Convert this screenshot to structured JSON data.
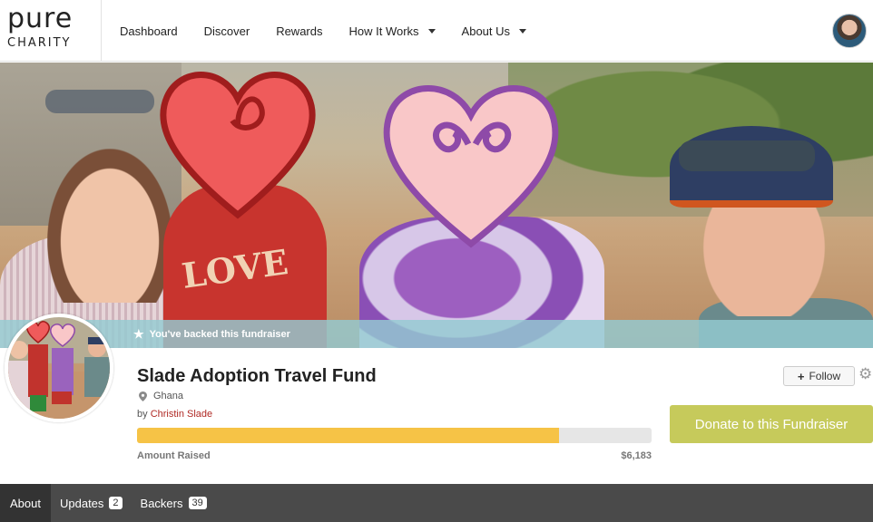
{
  "logo": {
    "line1": "pure",
    "line2": "CHARITY"
  },
  "nav": [
    {
      "label": "Dashboard",
      "dropdown": false
    },
    {
      "label": "Discover",
      "dropdown": false
    },
    {
      "label": "Rewards",
      "dropdown": false
    },
    {
      "label": "How It Works",
      "dropdown": true
    },
    {
      "label": "About Us",
      "dropdown": true
    }
  ],
  "banner": {
    "backed_text": "You've backed this fundraiser",
    "icon": "star-icon"
  },
  "fundraiser": {
    "title": "Slade Adoption Travel Fund",
    "location": "Ghana",
    "by_prefix": "by",
    "author": "Christin Slade",
    "amount_label": "Amount Raised",
    "amount": "$6,183",
    "progress_fraction": 0.82
  },
  "actions": {
    "follow": "Follow",
    "donate": "Donate to this Fundraiser"
  },
  "tabs": [
    {
      "label": "About",
      "count": null,
      "active": true
    },
    {
      "label": "Updates",
      "count": "2",
      "active": false
    },
    {
      "label": "Backers",
      "count": "39",
      "active": false
    }
  ],
  "colors": {
    "donate": "#c6ca5b",
    "progress": "#f6c346",
    "author_link": "#b02a25",
    "tabbar": "#4a4a4a"
  }
}
